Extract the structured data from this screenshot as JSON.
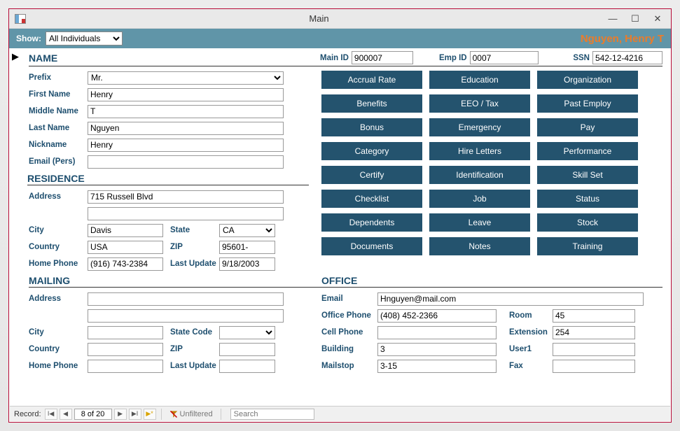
{
  "window": {
    "title": "Main"
  },
  "topbar": {
    "showLabel": "Show:",
    "selected": "All Individuals",
    "displayName": "Nguyen, Henry T"
  },
  "header": {
    "nameTitle": "NAME",
    "mainIdLabel": "Main ID",
    "mainId": "900007",
    "empIdLabel": "Emp ID",
    "empId": "0007",
    "ssnLabel": "SSN",
    "ssn": "542-12-4216"
  },
  "name": {
    "prefixLabel": "Prefix",
    "prefix": "Mr.",
    "firstNameLabel": "First Name",
    "firstName": "Henry",
    "middleNameLabel": "Middle Name",
    "middleName": "T",
    "lastNameLabel": "Last Name",
    "lastName": "Nguyen",
    "nicknameLabel": "Nickname",
    "nickname": "Henry",
    "emailPersLabel": "Email (Pers)",
    "emailPers": ""
  },
  "residence": {
    "title": "RESIDENCE",
    "addressLabel": "Address",
    "address1": "715 Russell Blvd",
    "address2": "",
    "cityLabel": "City",
    "city": "Davis",
    "stateLabel": "State",
    "state": "CA",
    "countryLabel": "Country",
    "country": "USA",
    "zipLabel": "ZIP",
    "zip": "95601-",
    "homePhoneLabel": "Home Phone",
    "homePhone": "(916) 743-2384",
    "lastUpdateLabel": "Last Update",
    "lastUpdate": "9/18/2003"
  },
  "mailing": {
    "title": "MAILING",
    "addressLabel": "Address",
    "address1": "",
    "address2": "",
    "cityLabel": "City",
    "city": "",
    "stateCodeLabel": "State Code",
    "stateCode": "",
    "countryLabel": "Country",
    "country": "",
    "zipLabel": "ZIP",
    "zip": "",
    "homePhoneLabel": "Home Phone",
    "homePhone": "",
    "lastUpdateLabel": "Last Update",
    "lastUpdate": ""
  },
  "navButtons": [
    "Accrual Rate",
    "Education",
    "Organization",
    "Benefits",
    "EEO / Tax",
    "Past Employ",
    "Bonus",
    "Emergency",
    "Pay",
    "Category",
    "Hire Letters",
    "Performance",
    "Certify",
    "Identification",
    "Skill Set",
    "Checklist",
    "Job",
    "Status",
    "Dependents",
    "Leave",
    "Stock",
    "Documents",
    "Notes",
    "Training"
  ],
  "office": {
    "title": "OFFICE",
    "emailLabel": "Email",
    "email": "Hnguyen@mail.com",
    "officePhoneLabel": "Office Phone",
    "officePhone": "(408) 452-2366",
    "cellPhoneLabel": "Cell Phone",
    "cellPhone": "",
    "buildingLabel": "Building",
    "building": "3",
    "mailstopLabel": "Mailstop",
    "mailstop": "3-15",
    "roomLabel": "Room",
    "room": "45",
    "extensionLabel": "Extension",
    "extension": "254",
    "user1Label": "User1",
    "user1": "",
    "faxLabel": "Fax",
    "fax": ""
  },
  "record": {
    "label": "Record:",
    "position": "8 of 20",
    "filter": "Unfiltered",
    "searchPlaceholder": "Search"
  }
}
